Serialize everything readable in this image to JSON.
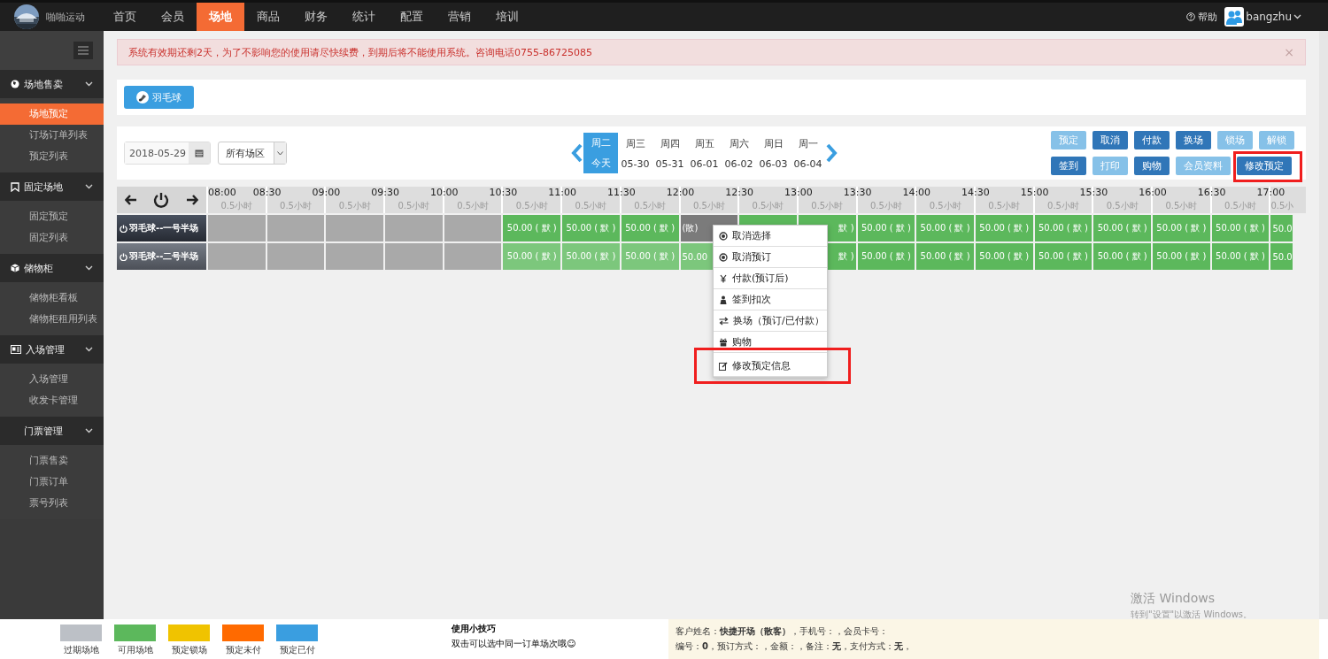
{
  "topbar": {
    "brand": "啪啪运动",
    "nav": [
      {
        "label": "首页",
        "selected": false
      },
      {
        "label": "会员",
        "selected": false
      },
      {
        "label": "场地",
        "selected": true
      },
      {
        "label": "商品",
        "selected": false
      },
      {
        "label": "财务",
        "selected": false
      },
      {
        "label": "统计",
        "selected": false
      },
      {
        "label": "配置",
        "selected": false
      },
      {
        "label": "营销",
        "selected": false
      },
      {
        "label": "培训",
        "selected": false
      }
    ],
    "help": "帮助",
    "user": "bangzhu"
  },
  "sidebar": {
    "groups": [
      {
        "label": "场地售卖",
        "items": [
          {
            "label": "场地预定",
            "selected": true
          },
          {
            "label": "订场订单列表",
            "selected": false
          },
          {
            "label": "预定列表",
            "selected": false
          }
        ]
      },
      {
        "label": "固定场地",
        "items": [
          {
            "label": "固定预定",
            "selected": false
          },
          {
            "label": "固定列表",
            "selected": false
          }
        ]
      },
      {
        "label": "储物柜",
        "items": [
          {
            "label": "储物柜看板",
            "selected": false
          },
          {
            "label": "储物柜租用列表",
            "selected": false
          }
        ]
      },
      {
        "label": "入场管理",
        "items": [
          {
            "label": "入场管理",
            "selected": false
          },
          {
            "label": "收发卡管理",
            "selected": false
          }
        ]
      },
      {
        "label": "门票管理",
        "items": [
          {
            "label": "门票售卖",
            "selected": false
          },
          {
            "label": "门票订单",
            "selected": false
          },
          {
            "label": "票号列表",
            "selected": false
          }
        ]
      }
    ]
  },
  "alert": {
    "text": "系统有效期还剩2天，为了不影响您的使用请尽快续费，到期后将不能使用系统。咨询电话0755-86725085",
    "close": "×"
  },
  "sport_button": "羽毛球",
  "filters": {
    "date": "2018-05-29",
    "area": "所有场区"
  },
  "days": [
    {
      "week": "周二",
      "date": "今天",
      "selected": true
    },
    {
      "week": "周三",
      "date": "05-30",
      "selected": false
    },
    {
      "week": "周四",
      "date": "05-31",
      "selected": false
    },
    {
      "week": "周五",
      "date": "06-01",
      "selected": false
    },
    {
      "week": "周六",
      "date": "06-02",
      "selected": false
    },
    {
      "week": "周日",
      "date": "06-03",
      "selected": false
    },
    {
      "week": "周一",
      "date": "06-04",
      "selected": false
    }
  ],
  "actions": [
    [
      {
        "label": "预定",
        "disabled": true
      },
      {
        "label": "取消",
        "disabled": false
      },
      {
        "label": "付款",
        "disabled": false
      },
      {
        "label": "换场",
        "disabled": false
      },
      {
        "label": "锁场",
        "disabled": true
      },
      {
        "label": "解锁",
        "disabled": true
      }
    ],
    [
      {
        "label": "签到",
        "disabled": false
      },
      {
        "label": "打印",
        "disabled": true
      },
      {
        "label": "购物",
        "disabled": false
      },
      {
        "label": "会员资料",
        "disabled": true
      },
      {
        "label": "修改预定",
        "disabled": false,
        "highlighted": true
      }
    ]
  ],
  "schedule": {
    "columns": [
      {
        "time": "08:00",
        "duration": "0.5小时"
      },
      {
        "time": "08:30",
        "duration": "0.5小时"
      },
      {
        "time": "09:00",
        "duration": "0.5小时"
      },
      {
        "time": "09:30",
        "duration": "0.5小时"
      },
      {
        "time": "10:00",
        "duration": "0.5小时"
      },
      {
        "time": "10:30",
        "duration": "0.5小时"
      },
      {
        "time": "11:00",
        "duration": "0.5小时"
      },
      {
        "time": "11:30",
        "duration": "0.5小时"
      },
      {
        "time": "12:00",
        "duration": "0.5小时"
      },
      {
        "time": "12:30",
        "duration": "0.5小时"
      },
      {
        "time": "13:00",
        "duration": "0.5小时"
      },
      {
        "time": "13:30",
        "duration": "0.5小时"
      },
      {
        "time": "14:00",
        "duration": "0.5小时"
      },
      {
        "time": "14:30",
        "duration": "0.5小时"
      },
      {
        "time": "15:00",
        "duration": "0.5小时"
      },
      {
        "time": "15:30",
        "duration": "0.5小时"
      },
      {
        "time": "16:00",
        "duration": "0.5小时"
      },
      {
        "time": "16:30",
        "duration": "0.5小时"
      },
      {
        "time": "17:00",
        "duration": "0.5小"
      }
    ],
    "courts": [
      {
        "name": "羽毛球--一号半场",
        "selected": true,
        "slots": [
          {
            "kind": "expired"
          },
          {
            "kind": "expired"
          },
          {
            "kind": "expired"
          },
          {
            "kind": "expired"
          },
          {
            "kind": "expired"
          },
          {
            "kind": "available",
            "text": "50.00 ( 默 )"
          },
          {
            "kind": "available",
            "text": "50.00 ( 默 )"
          },
          {
            "kind": "available",
            "text": "50.00 ( 默 )"
          },
          {
            "kind": "selected",
            "text": "(散)"
          },
          {
            "kind": "available"
          },
          {
            "kind": "available",
            "text": "默 )"
          },
          {
            "kind": "available",
            "text": "50.00 ( 默 )"
          },
          {
            "kind": "available",
            "text": "50.00 ( 默 )"
          },
          {
            "kind": "available",
            "text": "50.00 ( 默 )"
          },
          {
            "kind": "available",
            "text": "50.00 ( 默 )"
          },
          {
            "kind": "available",
            "text": "50.00 ( 默 )"
          },
          {
            "kind": "available",
            "text": "50.00 ( 默 )"
          },
          {
            "kind": "available",
            "text": "50.00 ( 默 )"
          },
          {
            "kind": "available",
            "text": "50.0"
          }
        ]
      },
      {
        "name": "羽毛球--二号半场",
        "selected": false,
        "slots": [
          {
            "kind": "expired"
          },
          {
            "kind": "expired"
          },
          {
            "kind": "expired"
          },
          {
            "kind": "expired"
          },
          {
            "kind": "expired"
          },
          {
            "kind": "hover",
            "text": "50.00 ( 默 )"
          },
          {
            "kind": "hover",
            "text": "50.00 ( 默 )"
          },
          {
            "kind": "hover",
            "text": "50.00 ( 默 )"
          },
          {
            "kind": "hover",
            "text": "50.00"
          },
          {
            "kind": "covered"
          },
          {
            "kind": "available",
            "text": "默 )"
          },
          {
            "kind": "available",
            "text": "50.00 ( 默 )"
          },
          {
            "kind": "available",
            "text": "50.00 ( 默 )"
          },
          {
            "kind": "available",
            "text": "50.00 ( 默 )"
          },
          {
            "kind": "available",
            "text": "50.00 ( 默 )"
          },
          {
            "kind": "available",
            "text": "50.00 ( 默 )"
          },
          {
            "kind": "available",
            "text": "50.00 ( 默 )"
          },
          {
            "kind": "available",
            "text": "50.00 ( 默 )"
          },
          {
            "kind": "available",
            "text": "50.0"
          }
        ]
      }
    ]
  },
  "context_menu": [
    {
      "label": "取消选择",
      "highlighted": false
    },
    {
      "label": "取消预订",
      "highlighted": false
    },
    {
      "label": "付款(预订后)",
      "highlighted": false
    },
    {
      "label": "签到扣次",
      "highlighted": false
    },
    {
      "label": "换场（预订/已付款）",
      "highlighted": false
    },
    {
      "label": "购物",
      "highlighted": false
    },
    {
      "label": "修改预定信息",
      "highlighted": true
    }
  ],
  "legend": [
    {
      "label": "过期场地",
      "color": "#bcc0c6"
    },
    {
      "label": "可用场地",
      "color": "#5cb85c"
    },
    {
      "label": "预定锁场",
      "color": "#f0c300"
    },
    {
      "label": "预定未付",
      "color": "#ff6a00"
    },
    {
      "label": "预定已付",
      "color": "#3a9ee0"
    }
  ],
  "tips": {
    "title": "使用小技巧",
    "text": "双击可以选中同一订单场次哦☺"
  },
  "customer_info": [
    "客户姓名：**快捷开场（散客）**，手机号：，会员卡号：",
    "编号：**0**，预订方式：，金额：，备注：**无**，支付方式：**无**，"
  ],
  "os_overlay": {
    "title": "激活 Windows",
    "subtitle": "转到\"设置\"以激活 Windows。"
  }
}
